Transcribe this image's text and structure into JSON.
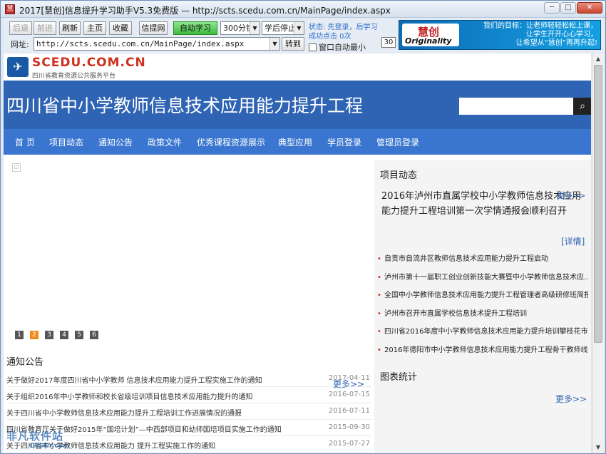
{
  "window": {
    "app_icon": "app-icon",
    "title": "2017[慧创]信息提升学习助手V5.3免费版 — http://scts.scedu.com.cn/MainPage/index.aspx",
    "min": "─",
    "max": "□",
    "close": "✕"
  },
  "toolbar": {
    "back": "后退",
    "forward": "前进",
    "refresh": "刷新",
    "home": "主页",
    "favorite": "收藏",
    "info_net": "信提网",
    "auto_learn": "自动学习",
    "duration": "300分钟",
    "after_learn": "学后停止",
    "url_label": "网址:",
    "url": "http://scts.scedu.com.cn/MainPage/index.aspx",
    "go": "转到",
    "status_line1": "状态: 先登录，后学习",
    "status_line2": "成功点击 0次",
    "minimize_label": "窗口自动最小",
    "count": "30"
  },
  "banner": {
    "logo_cn": "慧创",
    "logo_en": "Originality",
    "line1": "我们的目标：让老师轻轻松松上课，",
    "line2": "让学生开开心心学习，",
    "line3": "让希望从“慧创”再再升起!"
  },
  "site": {
    "logo_name": "SCEDU.COM.CN",
    "logo_sub": "四川省教育资源公共服务平台",
    "hero_title": "四川省中小学教师信息技术应用能力提升工程",
    "search_icon": "search-icon"
  },
  "nav": [
    "首 页",
    "项目动态",
    "通知公告",
    "政策文件",
    "优秀课程资源展示",
    "典型应用",
    "学员登录",
    "管理员登录"
  ],
  "slideshow": {
    "dots": [
      "1",
      "2",
      "3",
      "4",
      "5",
      "6"
    ],
    "active_dot": 2
  },
  "news": {
    "heading": "通知公告",
    "more": "更多>>",
    "items": [
      {
        "title": "关于做好2017年度四川省中小学教师 信息技术应用能力提升工程实施工作的通知",
        "date": "2017-04-11"
      },
      {
        "title": "关于组织2016年中小学教师和校长省级培训项目信息技术应用能力提升的通知",
        "date": "2016-07-15"
      },
      {
        "title": "关于四川省中小学教师信息技术应用能力提升工程培训工作进展情况的通报",
        "date": "2016-07-11"
      },
      {
        "title": "四川省教育厅关于做好2015年“国培计划”—中西部项目和幼师国培项目实施工作的通知",
        "date": "2015-09-30"
      },
      {
        "title": "关于四川省中小学教师信息技术应用能力 提升工程实施工作的通知",
        "date": "2015-07-27"
      }
    ]
  },
  "project": {
    "heading": "项目动态",
    "featured_title": "2016年泸州市直属学校中小学教师信息技术应用能力提升工程培训第一次学情通报会顺利召开",
    "featured_more": "更多>>",
    "detail": "[详情]",
    "items": [
      "自贡市自流井区教师信息技术应用能力提升工程启动",
      "泸州市第十一届职工创业创新技能大赛暨中小学教师信息技术应...",
      "全国中小学教师信息技术应用能力提升工程管理者高级研修班简报",
      "泸州市召开市直属学校信息技术提升工程培训",
      "四川省2016年度中小学教师信息技术应用能力提升培训攀枝花市...",
      "2016年德阳市中小学教师信息技术应用能力提升工程骨干教师线..."
    ]
  },
  "chart": {
    "heading": "图表统计",
    "more": "更多>>"
  },
  "watermark": {
    "cn": "非凡软件站",
    "en": "CRSKY.com"
  }
}
